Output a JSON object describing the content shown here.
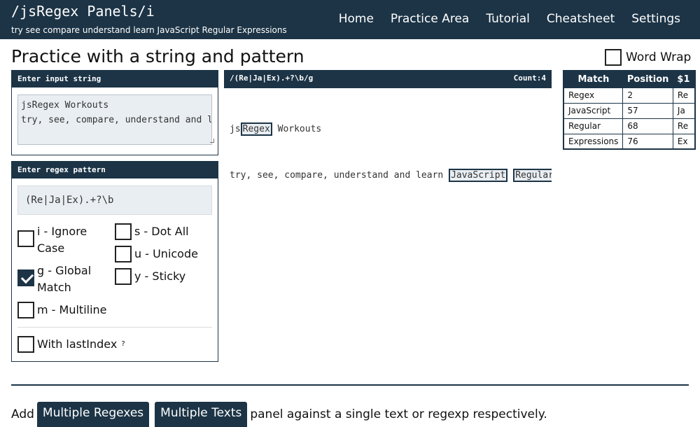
{
  "header": {
    "brand": "/jsRegex Panels/i",
    "tagline": "try see compare understand learn JavaScript Regular Expressions",
    "nav": [
      "Home",
      "Practice Area",
      "Tutorial",
      "Cheatsheet",
      "Settings"
    ]
  },
  "page": {
    "title": "Practice with a string and pattern",
    "word_wrap_label": "Word Wrap",
    "word_wrap_checked": false
  },
  "input_panel": {
    "title": "Enter input string",
    "value": "jsRegex Workouts\ntry, see, compare, understand and learn JavaScript Regular Expressions"
  },
  "regex_panel": {
    "title": "Enter regex pattern",
    "value": "(Re|Ja|Ex).+?\\b",
    "flags": [
      {
        "label": "i - Ignore Case",
        "checked": false
      },
      {
        "label": "g - Global Match",
        "checked": true
      },
      {
        "label": "m - Multiline",
        "checked": false
      },
      {
        "label": "s - Dot All",
        "checked": false
      },
      {
        "label": "u - Unicode",
        "checked": false
      },
      {
        "label": "y - Sticky",
        "checked": false
      }
    ],
    "last_index_label": "With lastIndex",
    "last_index_help": "?"
  },
  "result": {
    "pattern": "/(Re|Ja|Ex).+?\\b/g",
    "count": "Count:4",
    "line1_pre": "js",
    "line1_match": "Regex",
    "line1_post": " Workouts",
    "line2_pre": "try, see, compare, understand and learn ",
    "line2_match1": "JavaScript",
    "line2_sep": " ",
    "line2_match2": "Regular"
  },
  "match_table": {
    "headers": [
      "Match",
      "Position",
      "$1"
    ],
    "rows": [
      [
        "Regex",
        "2",
        "Re"
      ],
      [
        "JavaScript",
        "57",
        "Ja"
      ],
      [
        "Regular",
        "68",
        "Re"
      ],
      [
        "Expressions",
        "76",
        "Ex"
      ]
    ]
  },
  "footer": {
    "prefix": "Add",
    "btn1": "Multiple Regexes",
    "btn2": "Multiple Texts",
    "suffix": "panel against a single text or regexp respectively."
  },
  "colors": {
    "accent": "#1c3446",
    "field_bg": "#e9eef2"
  }
}
